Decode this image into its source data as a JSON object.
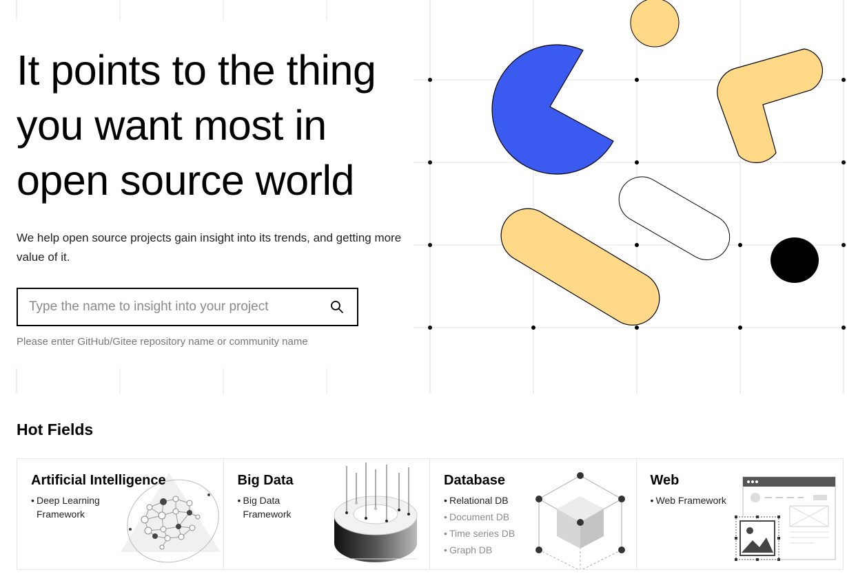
{
  "hero": {
    "title_line1": "It points to the thing",
    "title_line2": "you want most in",
    "title_line3": "open source world",
    "subtitle": "We help open source projects gain insight into its trends, and getting more value of it."
  },
  "search": {
    "placeholder": "Type the name to insight into your project",
    "hint": "Please enter GitHub/Gitee repository name or community name"
  },
  "hot_fields": {
    "title": "Hot Fields",
    "cards": [
      {
        "title": "Artificial Intelligence",
        "items": [
          "Deep Learning Framework"
        ]
      },
      {
        "title": "Big Data",
        "items": [
          "Big Data Framework"
        ]
      },
      {
        "title": "Database",
        "items": [
          "Relational DB",
          "Document DB",
          "Time series DB",
          "Graph DB"
        ]
      },
      {
        "title": "Web",
        "items": [
          "Web Framework"
        ]
      }
    ]
  },
  "colors": {
    "blue": "#3a5af0",
    "yellow": "#ffd987",
    "black": "#000000",
    "grid": "#e8e8e8"
  },
  "icons": [
    "search-icon",
    "neural-network-icon",
    "data-ring-icon",
    "database-cube-icon",
    "web-browser-icon"
  ]
}
